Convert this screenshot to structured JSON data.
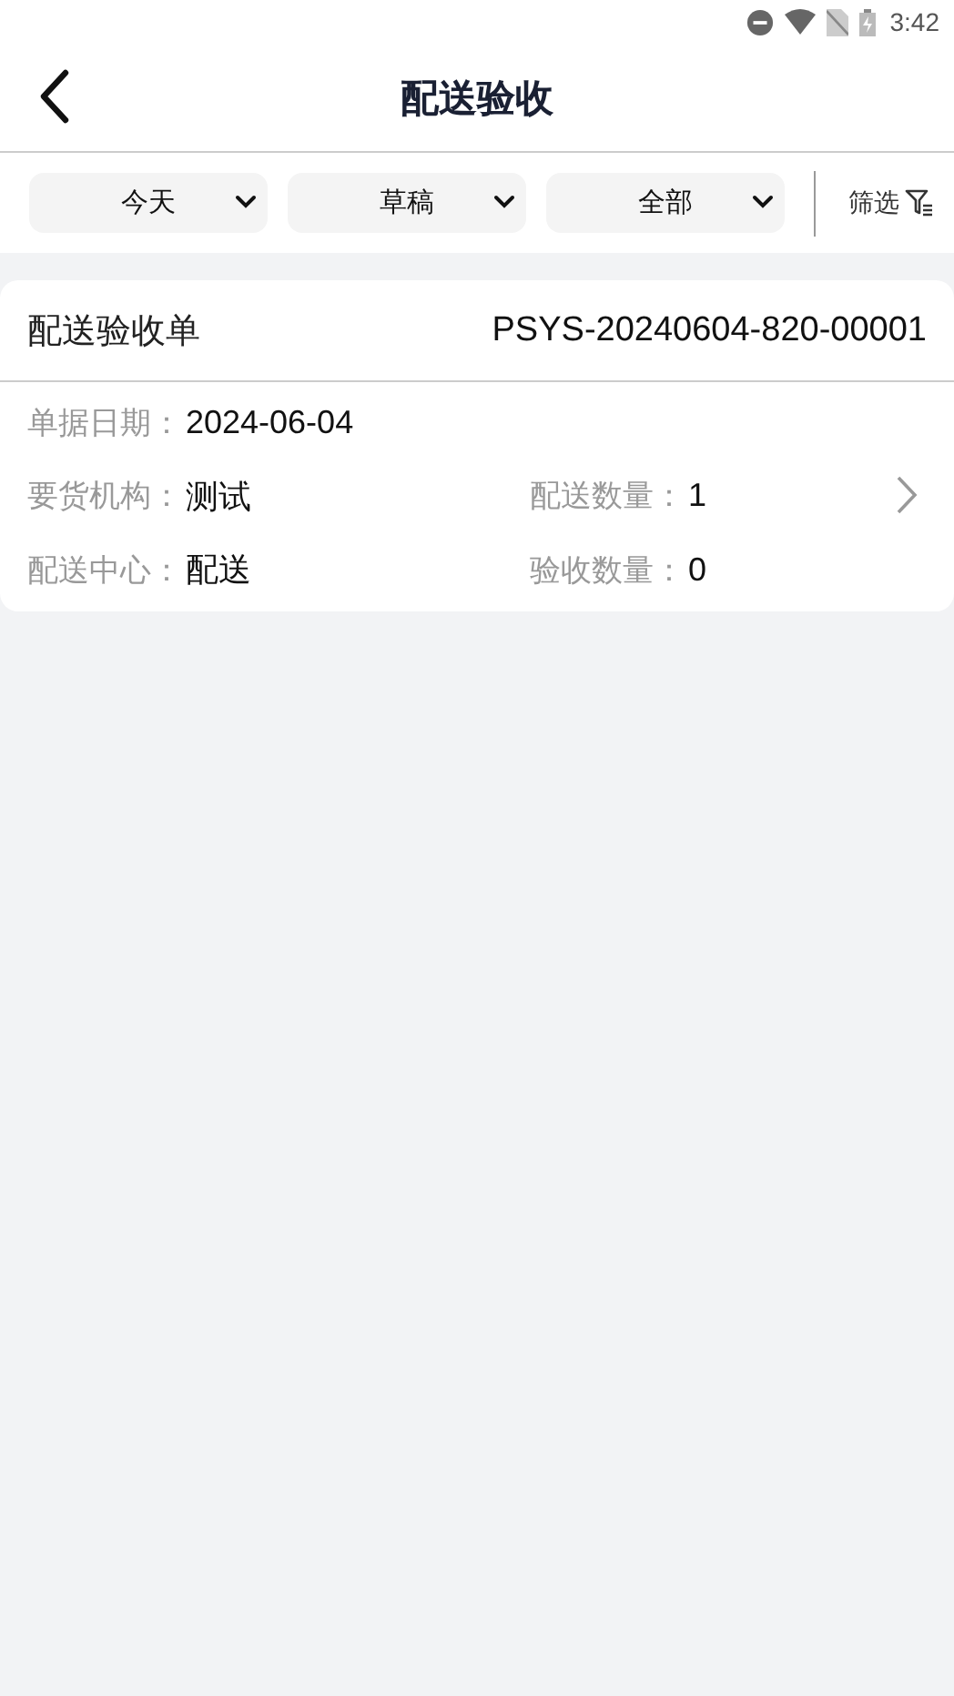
{
  "status_bar": {
    "time": "3:42"
  },
  "header": {
    "title": "配送验收"
  },
  "filters": [
    {
      "label": "今天"
    },
    {
      "label": "草稿"
    },
    {
      "label": "全部"
    }
  ],
  "filter_button": {
    "label": "筛选"
  },
  "orders": [
    {
      "type": "配送验收单",
      "number": "PSYS-20240604-820-00001",
      "fields": [
        {
          "label": "单据日期：",
          "value": "2024-06-04"
        },
        {
          "label": "要货机构：",
          "value": "测试"
        },
        {
          "label": "配送数量：",
          "value": "1"
        },
        {
          "label": "配送中心：",
          "value": "配送"
        },
        {
          "label": "验收数量：",
          "value": "0"
        }
      ]
    }
  ]
}
